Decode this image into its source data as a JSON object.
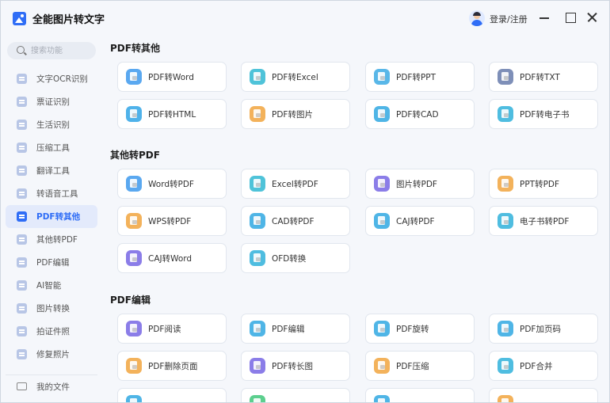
{
  "app": {
    "title": "全能图片转文字",
    "login_label": "登录/注册"
  },
  "sidebar": {
    "search_placeholder": "搜索功能",
    "items": [
      {
        "label": "文字OCR识别",
        "icon": "ocr-icon"
      },
      {
        "label": "票证识别",
        "icon": "ticket-icon"
      },
      {
        "label": "生活识别",
        "icon": "life-icon"
      },
      {
        "label": "压缩工具",
        "icon": "compress-icon"
      },
      {
        "label": "翻译工具",
        "icon": "translate-icon"
      },
      {
        "label": "转语音工具",
        "icon": "voice-icon"
      },
      {
        "label": "PDF转其他",
        "icon": "pdf-icon",
        "active": true
      },
      {
        "label": "其他转PDF",
        "icon": "to-pdf-icon"
      },
      {
        "label": "PDF编辑",
        "icon": "pdf-edit-icon"
      },
      {
        "label": "AI智能",
        "icon": "ai-icon"
      },
      {
        "label": "图片转换",
        "icon": "image-convert-icon"
      },
      {
        "label": "拍证件照",
        "icon": "id-photo-icon"
      },
      {
        "label": "修复照片",
        "icon": "repair-photo-icon"
      }
    ],
    "footer_label": "我的文件"
  },
  "sections": [
    {
      "title": "PDF转其他",
      "items": [
        {
          "label": "PDF转Word",
          "color": "#5aa8f0"
        },
        {
          "label": "PDF转Excel",
          "color": "#4fc3d9"
        },
        {
          "label": "PDF转PPT",
          "color": "#59b7e8"
        },
        {
          "label": "PDF转TXT",
          "color": "#7e8fb8"
        },
        {
          "label": "PDF转HTML",
          "color": "#4fb2ea"
        },
        {
          "label": "PDF转图片",
          "color": "#f3b25b"
        },
        {
          "label": "PDF转CAD",
          "color": "#4fb5e6"
        },
        {
          "label": "PDF转电子书",
          "color": "#4fbde0"
        }
      ]
    },
    {
      "title": "其他转PDF",
      "items": [
        {
          "label": "Word转PDF",
          "color": "#5aa8f0"
        },
        {
          "label": "Excel转PDF",
          "color": "#4fc3d9"
        },
        {
          "label": "图片转PDF",
          "color": "#8b7de8"
        },
        {
          "label": "PPT转PDF",
          "color": "#f3b25b"
        },
        {
          "label": "WPS转PDF",
          "color": "#f3b25b"
        },
        {
          "label": "CAD转PDF",
          "color": "#4fb5e6"
        },
        {
          "label": "CAJ转PDF",
          "color": "#4fb5e6"
        },
        {
          "label": "电子书转PDF",
          "color": "#4fbde0"
        },
        {
          "label": "CAJ转Word",
          "color": "#8b7de8"
        },
        {
          "label": "OFD转换",
          "color": "#4fbde0"
        }
      ]
    },
    {
      "title": "PDF编辑",
      "items": [
        {
          "label": "PDF阅读",
          "color": "#8b7de8"
        },
        {
          "label": "PDF编辑",
          "color": "#4fb5e6"
        },
        {
          "label": "PDF旋转",
          "color": "#4fb5e6"
        },
        {
          "label": "PDF加页码",
          "color": "#4fb5e6"
        },
        {
          "label": "PDF删除页面",
          "color": "#f3b25b"
        },
        {
          "label": "PDF转长图",
          "color": "#8b7de8"
        },
        {
          "label": "PDF压缩",
          "color": "#f3b25b"
        },
        {
          "label": "PDF合并",
          "color": "#4fbde0"
        }
      ]
    }
  ]
}
